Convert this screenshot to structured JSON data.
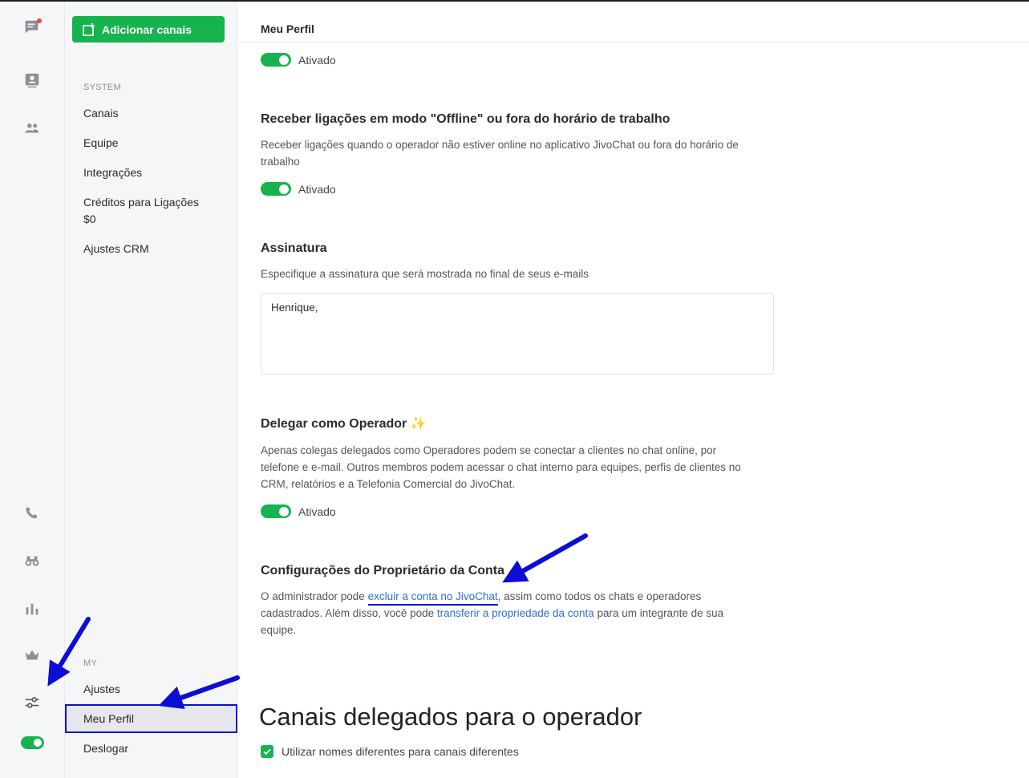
{
  "colors": {
    "accent": "#16b34f",
    "link": "#2f6fd6",
    "annotation": "#0d0dd6"
  },
  "rail": {
    "icons": [
      "chat-icon",
      "contacts-icon",
      "team-icon",
      "phone-icon",
      "binoculars-icon",
      "stats-icon",
      "crown-icon",
      "sliders-icon"
    ]
  },
  "sidebar": {
    "add_button": "Adicionar canais",
    "system_label": "SYSTEM",
    "system_items": [
      "Canais",
      "Equipe",
      "Integrações",
      "Créditos para Ligações",
      "$0",
      "Ajustes CRM"
    ],
    "my_label": "MY",
    "my_items": [
      "Ajustes",
      "Meu Perfil",
      "Deslogar"
    ]
  },
  "main": {
    "header_title": "Meu Perfil",
    "toggle_label": "Ativado",
    "offline": {
      "title": "Receber ligações em modo \"Offline\" ou fora do horário de trabalho",
      "desc": "Receber ligações quando o operador não estiver online no aplicativo JivoChat ou fora do horário de trabalho"
    },
    "signature": {
      "title": "Assinatura",
      "desc": "Especifique a assinatura que será mostrada no final de seus e-mails",
      "value": "Henrique,"
    },
    "delegate": {
      "title": "Delegar como Operador",
      "sparkle": "✨",
      "desc": "Apenas colegas delegados como Operadores podem se conectar a clientes no chat online, por telefone e e-mail. Outros membros podem acessar o chat interno para equipes, perfis de clientes no CRM, relatórios e a Telefonia Comercial do JivoChat."
    },
    "owner": {
      "title": "Configurações do Proprietário da Conta",
      "text1": "O administrador pode ",
      "link1": "excluir a conta no JivoChat",
      "text2": ", assim como todos os chats e operadores cadastrados. Além disso, você pode ",
      "link2": "transferir a propriedade da conta",
      "text3": " para um integrante de sua equipe."
    },
    "channels": {
      "title": "Canais delegados para o operador",
      "checkbox_label": "Utilizar nomes diferentes para canais diferentes"
    }
  }
}
